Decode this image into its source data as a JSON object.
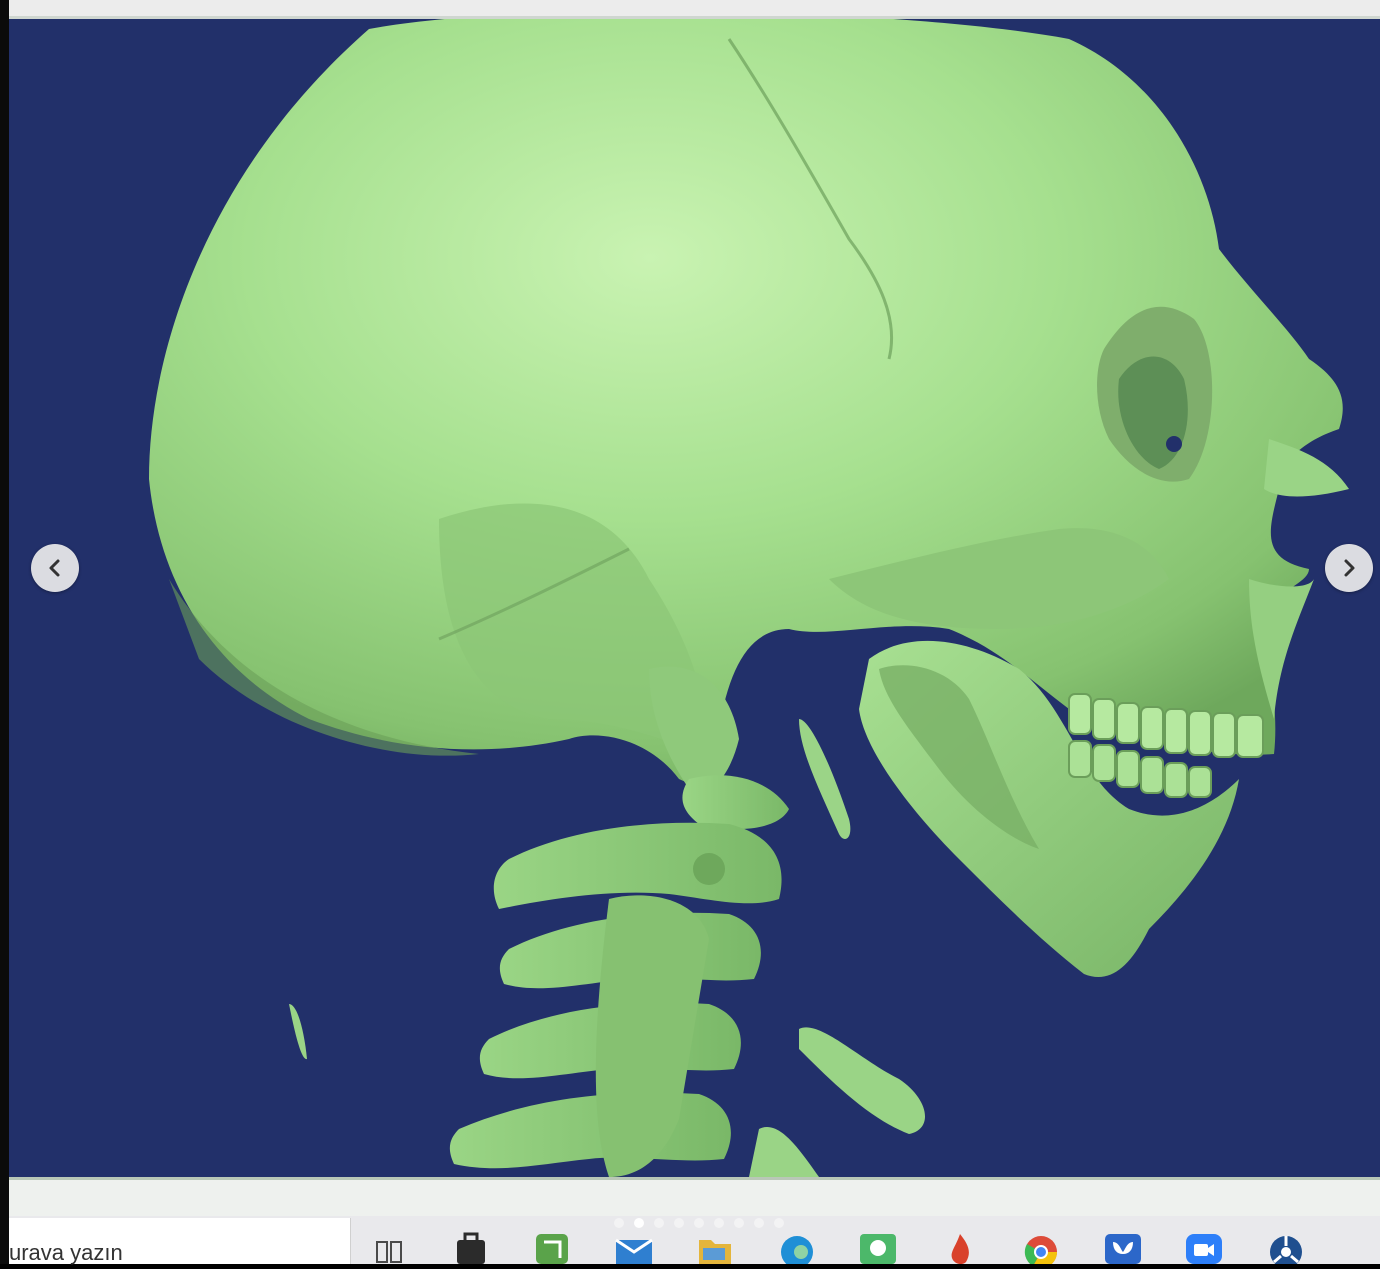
{
  "taskbar": {
    "search_placeholder": "urava yazın",
    "apps": [
      {
        "name": "task-view-icon",
        "color": "#4a4a4a"
      },
      {
        "name": "store-icon",
        "color": "#2b2b2b"
      },
      {
        "name": "notes-app-icon",
        "color": "#5aa34a"
      },
      {
        "name": "mail-icon",
        "color": "#2f7fd0"
      },
      {
        "name": "file-explorer-icon",
        "color": "#e4b53c"
      },
      {
        "name": "edge-icon",
        "color": "#1f8fd6"
      },
      {
        "name": "chat-icon",
        "color": "#4cb86a"
      },
      {
        "name": "flame-app-icon",
        "color": "#d9412b"
      },
      {
        "name": "chrome-icon",
        "color": "#dd4b39"
      },
      {
        "name": "butterfly-app-icon",
        "color": "#2c67c9"
      },
      {
        "name": "video-call-icon",
        "color": "#2d7ff9"
      },
      {
        "name": "settings-app-icon",
        "color": "#1f4f8f"
      }
    ]
  },
  "carousel": {
    "prev_label": "‹",
    "next_label": "›",
    "slide_count": 9,
    "active_slide": 2
  },
  "colors": {
    "viewport_background": "#22306a",
    "bone": "#9fd98a",
    "bone_shadow": "#6ea85c",
    "bone_highlight": "#c5f0ae"
  }
}
